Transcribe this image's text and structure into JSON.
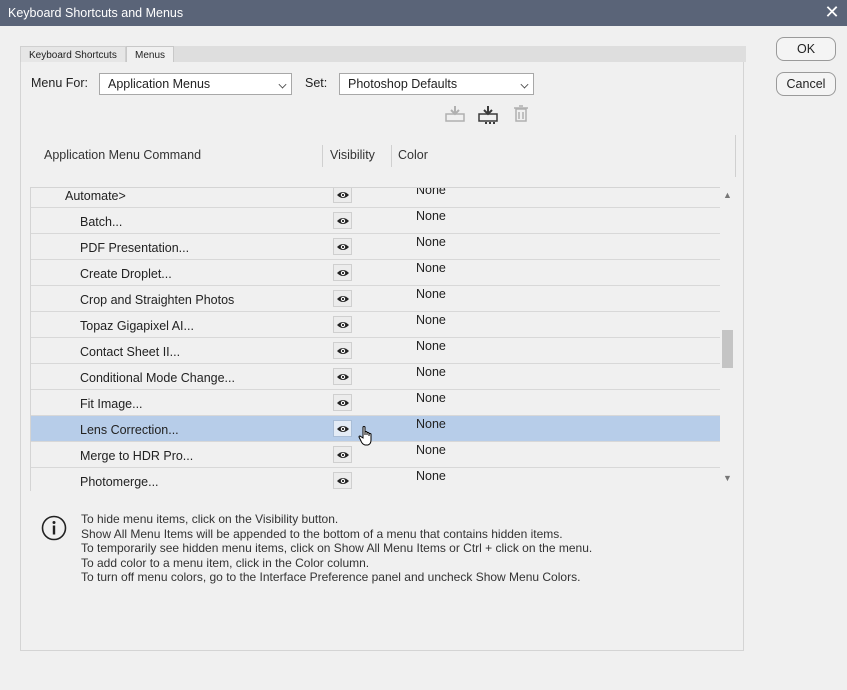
{
  "window": {
    "title": "Keyboard Shortcuts and Menus",
    "close_glyph": "✕"
  },
  "tabs": [
    {
      "label": "Keyboard Shortcuts"
    },
    {
      "label": "Menus"
    }
  ],
  "buttons": {
    "ok": "OK",
    "cancel": "Cancel"
  },
  "menu_for": {
    "label": "Menu For:",
    "value": "Application Menus"
  },
  "set": {
    "label": "Set:",
    "value": "Photoshop Defaults"
  },
  "toolbar_icons": [
    "save-set-icon",
    "save-as-set-icon",
    "delete-set-icon"
  ],
  "columns": {
    "command": "Application Menu Command",
    "visibility": "Visibility",
    "color": "Color"
  },
  "rows": [
    {
      "name": "Automate>",
      "color": "None",
      "indent": 0,
      "selected": false
    },
    {
      "name": "Batch...",
      "color": "None",
      "indent": 1,
      "selected": false
    },
    {
      "name": "PDF Presentation...",
      "color": "None",
      "indent": 1,
      "selected": false
    },
    {
      "name": "Create Droplet...",
      "color": "None",
      "indent": 1,
      "selected": false
    },
    {
      "name": "Crop and Straighten Photos",
      "color": "None",
      "indent": 1,
      "selected": false
    },
    {
      "name": "Topaz Gigapixel AI...",
      "color": "None",
      "indent": 1,
      "selected": false
    },
    {
      "name": "Contact Sheet II...",
      "color": "None",
      "indent": 1,
      "selected": false
    },
    {
      "name": "Conditional Mode Change...",
      "color": "None",
      "indent": 1,
      "selected": false
    },
    {
      "name": "Fit Image...",
      "color": "None",
      "indent": 1,
      "selected": false
    },
    {
      "name": "Lens Correction...",
      "color": "None",
      "indent": 1,
      "selected": true
    },
    {
      "name": "Merge to HDR Pro...",
      "color": "None",
      "indent": 1,
      "selected": false
    },
    {
      "name": "Photomerge...",
      "color": "None",
      "indent": 1,
      "selected": false
    }
  ],
  "info_lines": [
    "To hide menu items, click on the Visibility button.",
    "Show All Menu Items will be appended to the bottom of a menu that contains hidden items.",
    "To temporarily see hidden menu items, click on Show All Menu Items or Ctrl + click on the menu.",
    "To add color to a menu item, click in the Color column.",
    "To turn off menu colors, go to the Interface Preference panel and uncheck Show Menu Colors."
  ],
  "colors": {
    "titlebar": "#5a6478",
    "selected_row": "#b7cde9",
    "background": "#f0f0f0"
  }
}
